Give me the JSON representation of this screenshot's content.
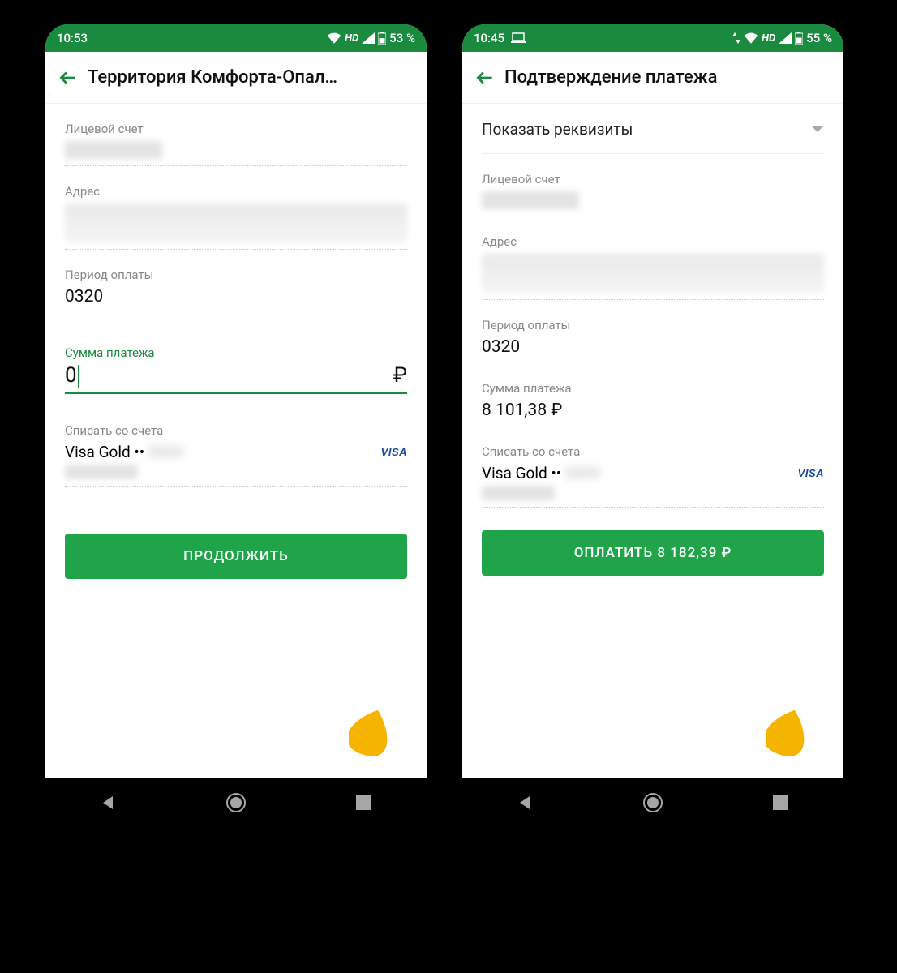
{
  "left": {
    "status": {
      "time": "10:53",
      "hd": "HD",
      "battery": "53 %"
    },
    "title": "Территория Комфорта-Опал…",
    "fields": {
      "account_label": "Лицевой счет",
      "address_label": "Адрес",
      "period_label": "Период оплаты",
      "period_value": "0320",
      "amount_label": "Сумма платежа",
      "amount_value": "0",
      "currency": "₽",
      "source_label": "Списать со счета",
      "card_name": "Visa Gold ••"
    },
    "cta": "ПРОДОЛЖИТЬ"
  },
  "right": {
    "status": {
      "time": "10:45",
      "hd": "HD",
      "battery": "55 %"
    },
    "title": "Подтверждение платежа",
    "expand": "Показать реквизиты",
    "fields": {
      "account_label": "Лицевой счет",
      "address_label": "Адрес",
      "period_label": "Период оплаты",
      "period_value": "0320",
      "amount_label": "Сумма платежа",
      "amount_value": "8 101,38 ₽",
      "source_label": "Списать со счета",
      "card_name": "Visa Gold ••"
    },
    "cta": "ОПЛАТИТЬ 8 182,39 ₽"
  },
  "visa": "VISA"
}
